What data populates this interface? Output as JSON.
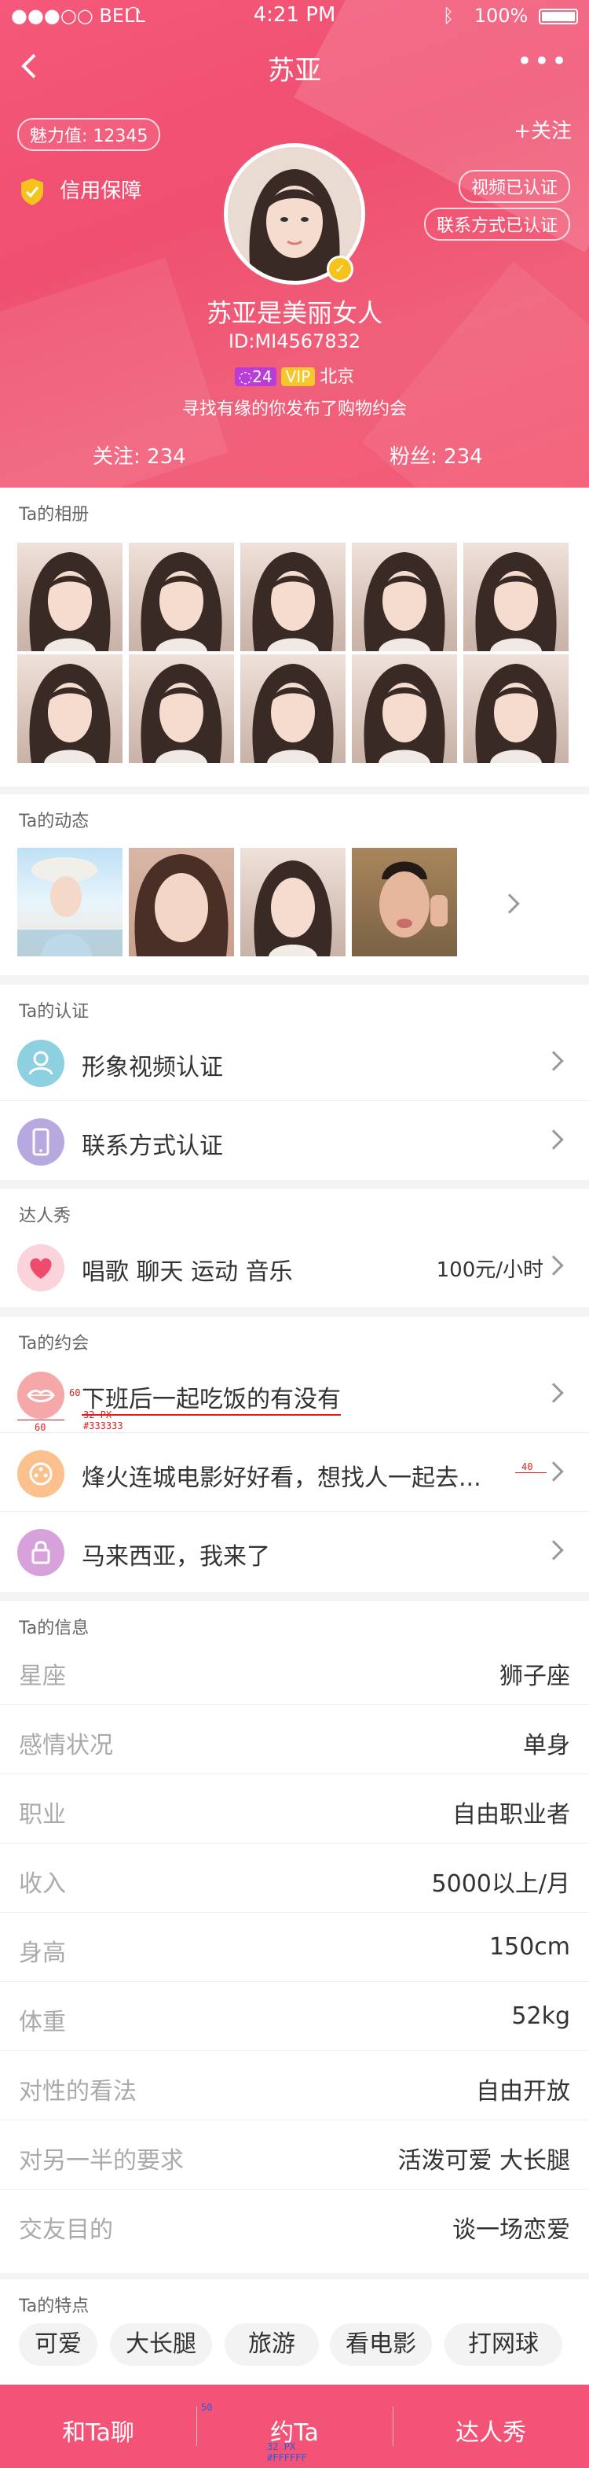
{
  "status": {
    "carrier": "●●●○○ BELL",
    "time": "4:21 PM",
    "battery": "100%"
  },
  "nav": {
    "title": "苏亚",
    "more": "•••"
  },
  "profile": {
    "charm": "魅力值: 12345",
    "follow": "+关注",
    "credit": "信用保障",
    "verify_video": "视频已认证",
    "verify_contact": "联系方式已认证",
    "name": "苏亚是美丽女人",
    "id": "ID:MI4567832",
    "level": "24",
    "vip": "VIP",
    "city": "北京",
    "motto": "寻找有缘的你发布了购物约会",
    "following": "关注: 234",
    "fans": "粉丝: 234"
  },
  "album": {
    "title": "Ta的相册"
  },
  "moments": {
    "title": "Ta的动态"
  },
  "cert": {
    "title": "Ta的认证",
    "items": [
      {
        "label": "形象视频认证"
      },
      {
        "label": "联系方式认证"
      }
    ]
  },
  "talent": {
    "title": "达人秀",
    "label": "唱歌  聊天  运动  音乐",
    "price": "100元/小时"
  },
  "dates": {
    "title": "Ta的约会",
    "items": [
      {
        "label": "下班后一起吃饭的有没有"
      },
      {
        "label": "烽火连城电影好好看，想找人一起去..."
      },
      {
        "label": "马来西亚，我来了"
      }
    ]
  },
  "info": {
    "title": "Ta的信息",
    "rows": [
      {
        "k": "星座",
        "v": "狮子座"
      },
      {
        "k": "感情状况",
        "v": "单身"
      },
      {
        "k": "职业",
        "v": "自由职业者"
      },
      {
        "k": "收入",
        "v": "5000以上/月"
      },
      {
        "k": "身高",
        "v": "150cm"
      },
      {
        "k": "体重",
        "v": "52kg"
      },
      {
        "k": "对性的看法",
        "v": "自由开放"
      },
      {
        "k": "对另一半的要求",
        "v": "活泼可爱 大长腿"
      },
      {
        "k": "交友目的",
        "v": "谈一场恋爱"
      }
    ]
  },
  "traits": {
    "title": "Ta的特点",
    "items": [
      "可爱",
      "大长腿",
      "旅游",
      "看电影",
      "打网球"
    ]
  },
  "tabbar": {
    "chat": "和Ta聊",
    "date": "约Ta",
    "talent": "达人秀"
  },
  "annotations": {
    "a60": "60",
    "a60b": "60",
    "a32": "32 PX",
    "acolor": "#333333",
    "a40": "40",
    "a50": "50",
    "a32b": "32 PX",
    "awhite": "#FFFFFF"
  },
  "colors": {
    "brand": "#f35377",
    "vip": "#f5c72a",
    "level": "#b93cd9"
  }
}
